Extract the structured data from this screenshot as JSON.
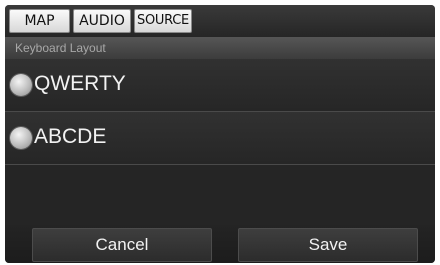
{
  "tabs": [
    {
      "label": "MAP"
    },
    {
      "label": "AUDIO"
    },
    {
      "label": "SOURCE"
    }
  ],
  "section": {
    "title": "Keyboard Layout"
  },
  "options": [
    {
      "label": "QWERTY",
      "icon": "radio-button-icon"
    },
    {
      "label": "ABCDE",
      "icon": "radio-button-icon"
    }
  ],
  "buttons": {
    "cancel": "Cancel",
    "save": "Save"
  }
}
